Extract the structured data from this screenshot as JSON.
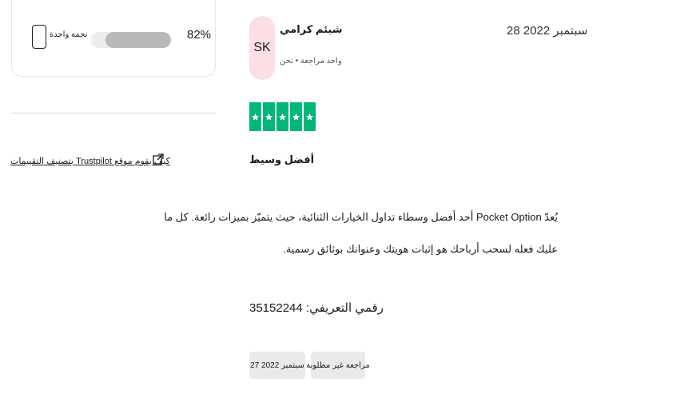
{
  "rating_summary": {
    "row": {
      "percent_text": "82%",
      "fill_fraction": 0.82,
      "label": "نجمة واحدة"
    }
  },
  "trustpilot_link": {
    "text": "كيف يقوم موقع Trustpilot بتصنيف التقييمات"
  },
  "review": {
    "date": "28 سبتمبر 2022",
    "avatar_initials": "SK",
    "reviewer_name": "شيئم كرامي",
    "reviewer_meta": "واحد مراجعة • نحن",
    "star_count": 5,
    "title": "أفضل وسيط",
    "body_line1": "يُعدّ Pocket Option أحد أفضل وسطاء تداول الخيارات الثنائية، حيث يتميّز بميزات رائعة. كل ما",
    "body_line2": "عليك فعله لسحب أرباحك هو إثبات هويتك وعنوانك بوثائق رسمية.",
    "reference": "رقمي التعريفي: 35152244",
    "tags": {
      "date": "27 سبتمبر 2022",
      "unsolicited": "مراجعة غير مطلوبة"
    }
  },
  "colors": {
    "star_green": "#00b67a",
    "avatar_bg": "#fbdfe5",
    "bar_fill": "#b9b9b9",
    "tag_bg": "#eaeaea"
  }
}
